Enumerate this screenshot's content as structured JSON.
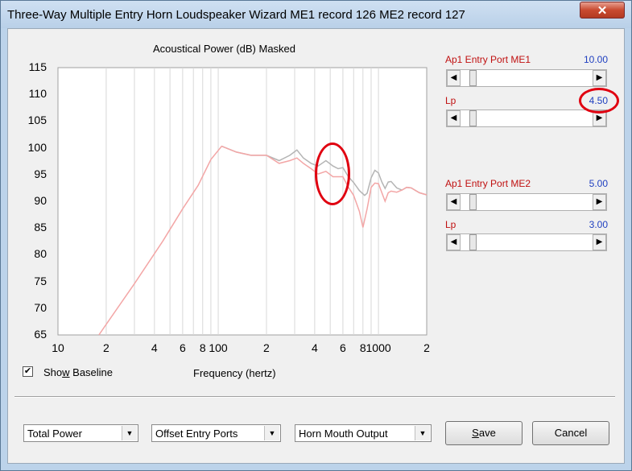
{
  "window": {
    "title": "Three-Way Multiple Entry Horn Loudspeaker Wizard   ME1 record 126   ME2 record 127",
    "close_glyph": "✕"
  },
  "chart_data": {
    "type": "line",
    "title": "Acoustical Power (dB)   Masked",
    "xlabel": "Frequency (hertz)",
    "ylabel": "",
    "x_scale": "log",
    "xlim": [
      10,
      2000
    ],
    "ylim": [
      65,
      115
    ],
    "yticks": [
      "115",
      "110",
      "105",
      "100",
      "95",
      "90",
      "85",
      "80",
      "75",
      "70",
      "65"
    ],
    "xticks": [
      {
        "label": "10",
        "value": 10
      },
      {
        "label": "2",
        "value": 20
      },
      {
        "label": "4",
        "value": 40
      },
      {
        "label": "6",
        "value": 60
      },
      {
        "label": "8",
        "value": 80
      },
      {
        "label": "100",
        "value": 100
      },
      {
        "label": "2",
        "value": 200
      },
      {
        "label": "4",
        "value": 400
      },
      {
        "label": "6",
        "value": 600
      },
      {
        "label": "8",
        "value": 800
      },
      {
        "label": "1000",
        "value": 1000
      },
      {
        "label": "2",
        "value": 2000
      }
    ],
    "grid": true,
    "series": [
      {
        "color": "#b4b4b4",
        "points": [
          [
            105,
            100.3
          ],
          [
            130,
            99.2
          ],
          [
            160,
            98.6
          ],
          [
            200,
            98.6
          ],
          [
            240,
            97.6
          ],
          [
            280,
            98.6
          ],
          [
            310,
            99.6
          ],
          [
            340,
            98.1
          ],
          [
            380,
            97.1
          ],
          [
            420,
            96.6
          ],
          [
            470,
            97.6
          ],
          [
            520,
            96.6
          ],
          [
            560,
            96.1
          ],
          [
            600,
            96.3
          ],
          [
            650,
            94.6
          ],
          [
            700,
            93.5
          ],
          [
            760,
            92.0
          ],
          [
            820,
            91.1
          ],
          [
            850,
            91.5
          ],
          [
            900,
            94.4
          ],
          [
            950,
            95.8
          ],
          [
            1000,
            95.3
          ],
          [
            1050,
            93.6
          ],
          [
            1100,
            92.4
          ],
          [
            1150,
            93.6
          ],
          [
            1200,
            93.7
          ],
          [
            1300,
            92.5
          ],
          [
            1400,
            92.1
          ],
          [
            1500,
            92.6
          ],
          [
            1600,
            92.5
          ],
          [
            1800,
            91.6
          ],
          [
            2000,
            91.2
          ]
        ]
      },
      {
        "color": "#f3a6a6",
        "points": [
          [
            18,
            65
          ],
          [
            30,
            74.6
          ],
          [
            45,
            82.5
          ],
          [
            60,
            88.6
          ],
          [
            75,
            93.0
          ],
          [
            90,
            97.8
          ],
          [
            105,
            100.3
          ],
          [
            130,
            99.2
          ],
          [
            160,
            98.6
          ],
          [
            200,
            98.6
          ],
          [
            240,
            97.1
          ],
          [
            280,
            97.6
          ],
          [
            310,
            98.1
          ],
          [
            340,
            97.1
          ],
          [
            380,
            96.1
          ],
          [
            420,
            95.1
          ],
          [
            470,
            95.6
          ],
          [
            520,
            94.6
          ],
          [
            560,
            94.6
          ],
          [
            600,
            94.6
          ],
          [
            650,
            92.6
          ],
          [
            700,
            91.1
          ],
          [
            760,
            88.1
          ],
          [
            800,
            85.1
          ],
          [
            850,
            88.6
          ],
          [
            900,
            92.6
          ],
          [
            950,
            93.4
          ],
          [
            1000,
            93.3
          ],
          [
            1050,
            91.6
          ],
          [
            1100,
            90.0
          ],
          [
            1150,
            91.6
          ],
          [
            1200,
            91.9
          ],
          [
            1300,
            91.7
          ],
          [
            1400,
            92.1
          ],
          [
            1500,
            92.6
          ],
          [
            1600,
            92.5
          ],
          [
            1800,
            91.6
          ],
          [
            2000,
            91.2
          ]
        ]
      }
    ]
  },
  "controls": {
    "show_baseline": {
      "label_pre": "Sho",
      "label_underline": "w",
      "label_post": " Baseline",
      "checked": true,
      "check_glyph": "✔"
    },
    "me1": {
      "label": "Ap1  Entry Port  ME1",
      "value": "10.00",
      "fraction": 0.02
    },
    "lp1": {
      "label": "Lp",
      "value": "4.50",
      "fraction": 0.02
    },
    "me2": {
      "label": "Ap1  Entry Port  ME2",
      "value": "5.00",
      "fraction": 0.02
    },
    "lp2": {
      "label": "Lp",
      "value": "3.00",
      "fraction": 0.02
    },
    "scroll_left_glyph": "◀",
    "scroll_right_glyph": "▶"
  },
  "footer": {
    "power_select": "Total Power",
    "entry_select": "Offset Entry Ports",
    "output_select": "Horn Mouth Output",
    "dropdown_glyph": "▼",
    "save_label_pre": "",
    "save_label_underline": "S",
    "save_label_post": "ave",
    "cancel_label": "Cancel"
  },
  "annotations": {
    "accent_color": "#e00010"
  }
}
